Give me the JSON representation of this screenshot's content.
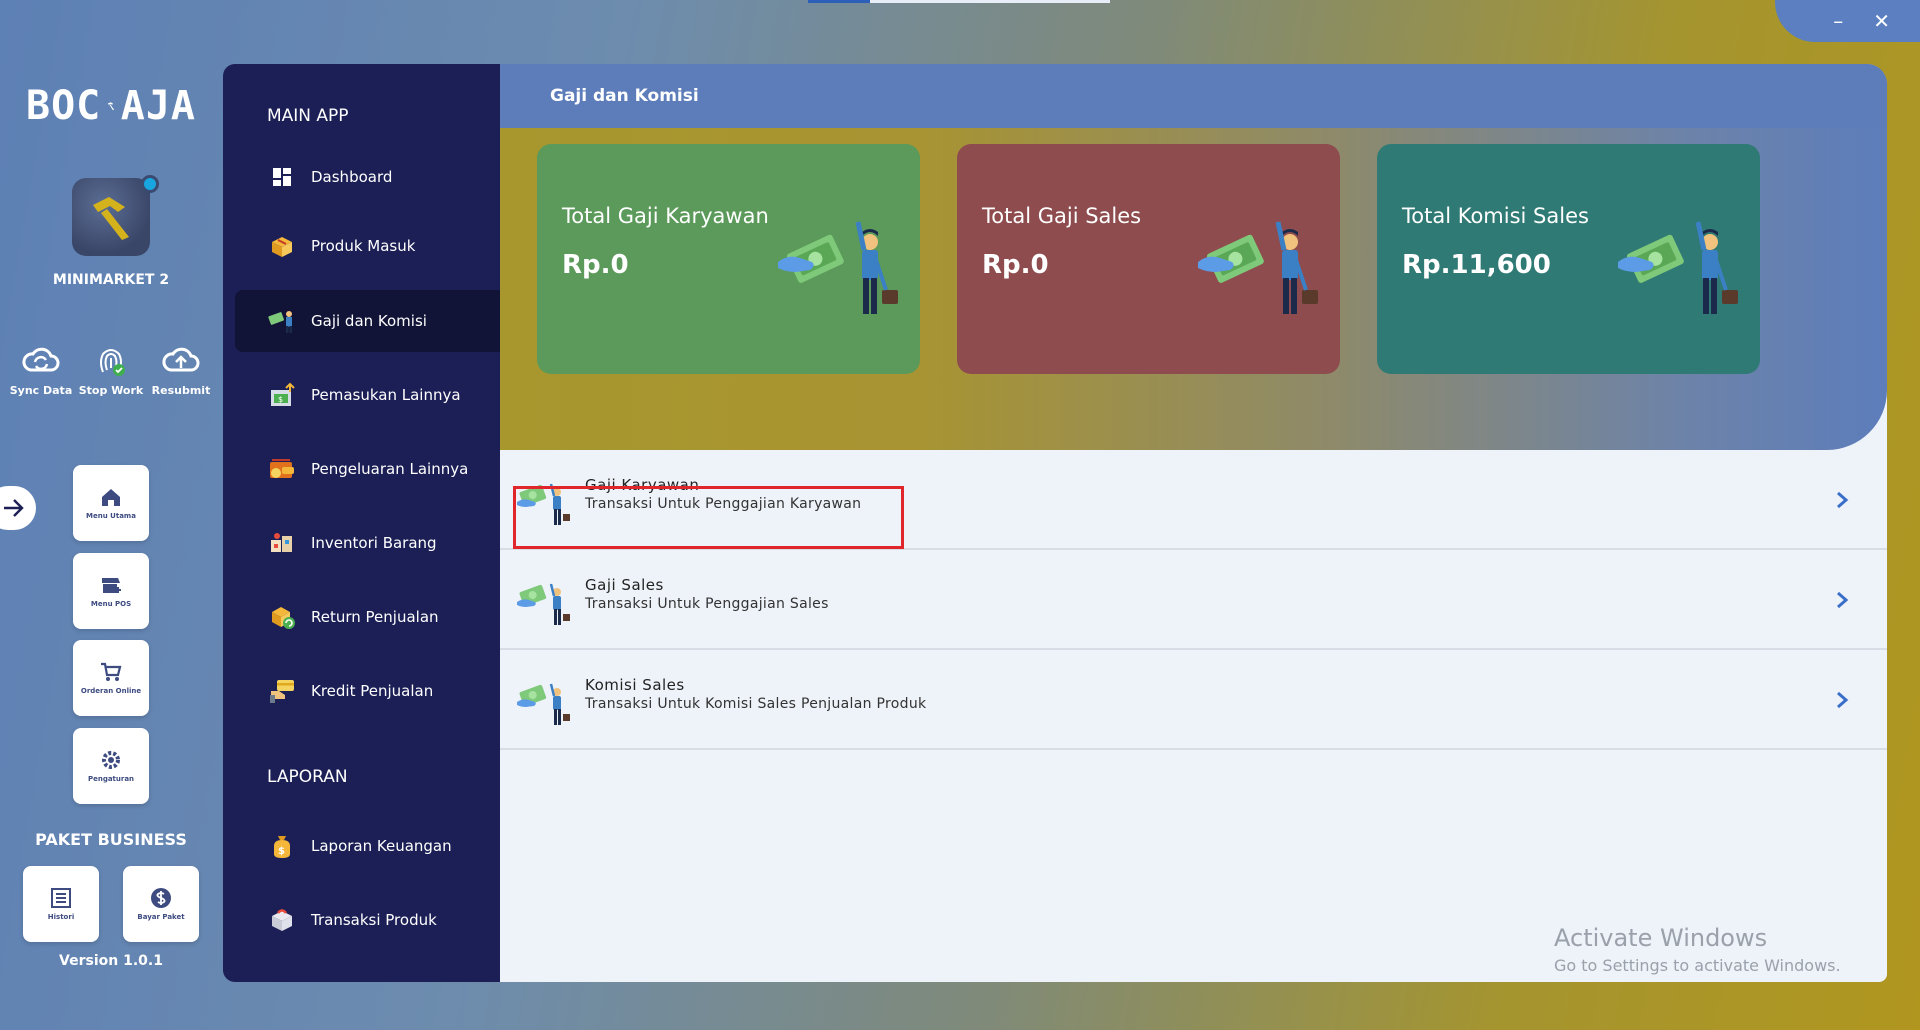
{
  "window": {
    "minimize_label": "–",
    "close_label": "✕"
  },
  "rail": {
    "logo_text_left": "BOC",
    "logo_text_right": "AJA",
    "store_name": "MINIMARKET 2",
    "quick_actions": [
      {
        "label": "Sync Data",
        "icon": "sync-cloud-icon"
      },
      {
        "label": "Stop Work",
        "icon": "fingerprint-icon"
      },
      {
        "label": "Resubmit",
        "icon": "upload-cloud-icon"
      }
    ],
    "tiles": [
      {
        "label": "Menu Utama",
        "icon": "home-icon"
      },
      {
        "label": "Menu POS",
        "icon": "store-icon"
      },
      {
        "label": "Orderan Online",
        "icon": "cart-icon"
      },
      {
        "label": "Pengaturan",
        "icon": "gear-icon"
      }
    ],
    "paket_title": "PAKET BUSINESS",
    "paket_tiles": [
      {
        "label": "Histori",
        "icon": "list-icon"
      },
      {
        "label": "Bayar Paket",
        "icon": "dollar-icon"
      }
    ],
    "version": "Version 1.0.1"
  },
  "sidebar": {
    "main_section": "MAIN APP",
    "main_items": [
      {
        "label": "Dashboard",
        "icon": "dashboard-icon"
      },
      {
        "label": "Produk Masuk",
        "icon": "box-icon"
      },
      {
        "label": "Gaji dan Komisi",
        "icon": "salary-icon",
        "active": true
      },
      {
        "label": "Pemasukan Lainnya",
        "icon": "income-icon"
      },
      {
        "label": "Pengeluaran Lainnya",
        "icon": "expense-icon"
      },
      {
        "label": "Inventori Barang",
        "icon": "inventory-icon"
      },
      {
        "label": "Return Penjualan",
        "icon": "return-icon"
      },
      {
        "label": "Kredit Penjualan",
        "icon": "credit-icon"
      }
    ],
    "report_section": "LAPORAN",
    "report_items": [
      {
        "label": "Laporan Keuangan",
        "icon": "money-bag-icon"
      },
      {
        "label": "Transaksi Produk",
        "icon": "product-box-icon"
      }
    ]
  },
  "main": {
    "title": "Gaji dan Komisi",
    "cards": [
      {
        "label": "Total Gaji Karyawan",
        "value": "Rp.0",
        "color": "#5b9a5a"
      },
      {
        "label": "Total Gaji Sales",
        "value": "Rp.0",
        "color": "#8e4c4e"
      },
      {
        "label": "Total Komisi Sales",
        "value": "Rp.11,600",
        "color": "#2f7a74"
      }
    ],
    "rows": [
      {
        "title": "Gaji Karyawan",
        "subtitle": "Transaksi Untuk Penggajian Karyawan"
      },
      {
        "title": "Gaji Sales",
        "subtitle": "Transaksi Untuk Penggajian Sales"
      },
      {
        "title": "Komisi Sales",
        "subtitle": "Transaksi Untuk Komisi Sales Penjualan Produk"
      }
    ]
  },
  "watermark": {
    "line1": "Activate Windows",
    "line2": "Go to Settings to activate Windows."
  }
}
